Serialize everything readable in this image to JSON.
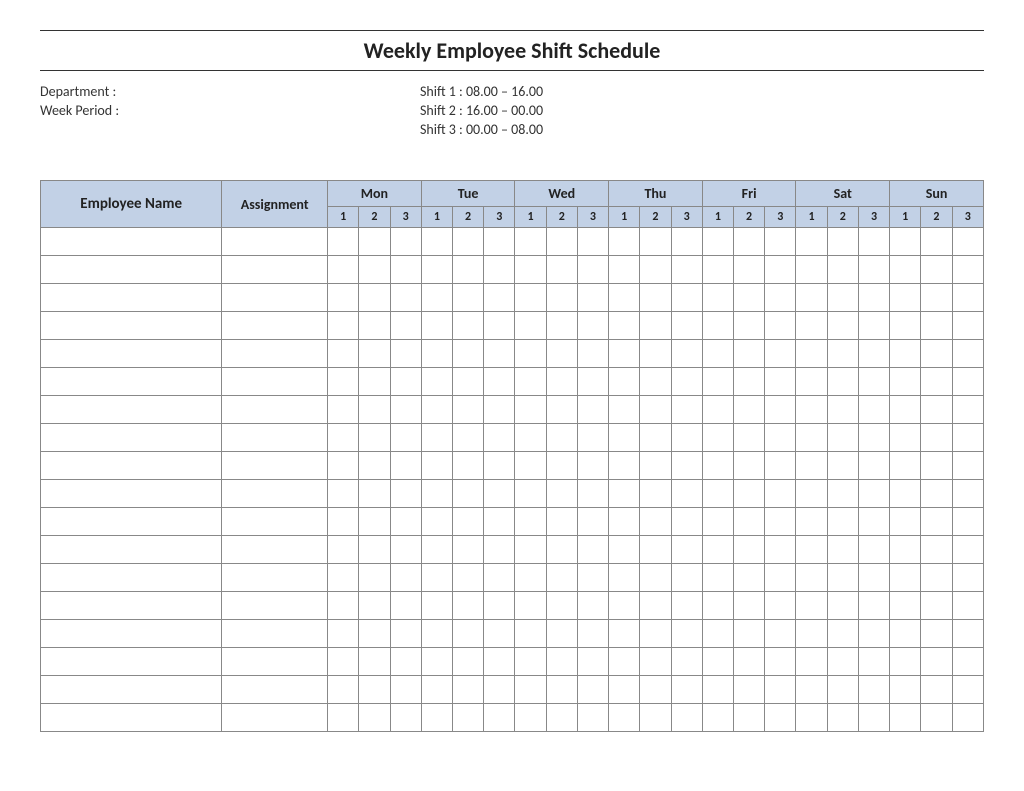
{
  "title": "Weekly Employee Shift Schedule",
  "meta": {
    "department_label": "Department    :",
    "week_period_label": "Week  Period :",
    "shift1_label": "Shift 1  : 08.00  – 16.00",
    "shift2_label": "Shift 2  : 16.00  – 00.00",
    "shift3_label": "Shift 3  : 00.00  – 08.00"
  },
  "headers": {
    "employee_name": "Employee Name",
    "assignment": "Assignment",
    "days": [
      "Mon",
      "Tue",
      "Wed",
      "Thu",
      "Fri",
      "Sat",
      "Sun"
    ],
    "shifts": [
      "1",
      "2",
      "3"
    ]
  },
  "row_count": 18
}
